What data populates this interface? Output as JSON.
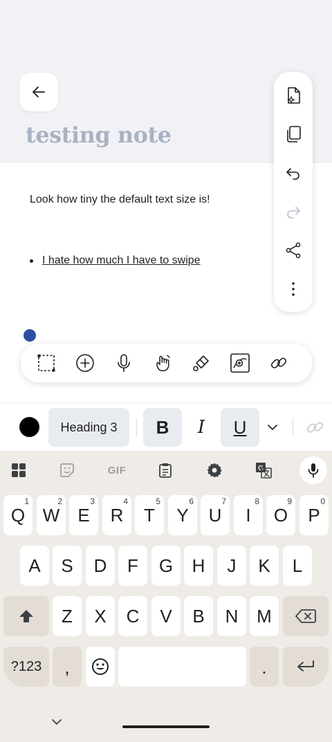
{
  "note": {
    "title": "testing note",
    "paragraph": "Look how tiny the default text size is!",
    "bullet": "I hate how much I have to swipe"
  },
  "side_toolbar": {
    "icons": [
      "ai-file-icon",
      "copy-icon",
      "undo-icon",
      "redo-icon",
      "share-icon",
      "more-vertical-icon"
    ]
  },
  "tool_bar": {
    "icons": [
      "selection-icon",
      "add-icon",
      "microphone-icon",
      "draw-icon",
      "eraser-icon",
      "image-insert-icon",
      "link-icon"
    ]
  },
  "format_bar": {
    "text_color": "#000000",
    "heading_label": "Heading 3",
    "bold_label": "B",
    "italic_label": "I",
    "underline_label": "U"
  },
  "keyboard": {
    "toolbar": {
      "gif_label": "GIF",
      "icons": [
        "apps-icon",
        "sticker-icon",
        "gif-icon",
        "clipboard-icon",
        "settings-icon",
        "translate-icon",
        "microphone-icon"
      ]
    },
    "row1": [
      {
        "k": "Q",
        "hint": "1"
      },
      {
        "k": "W",
        "hint": "2"
      },
      {
        "k": "E",
        "hint": "3"
      },
      {
        "k": "R",
        "hint": "4"
      },
      {
        "k": "T",
        "hint": "5"
      },
      {
        "k": "Y",
        "hint": "6"
      },
      {
        "k": "U",
        "hint": "7"
      },
      {
        "k": "I",
        "hint": "8"
      },
      {
        "k": "O",
        "hint": "9"
      },
      {
        "k": "P",
        "hint": "0"
      }
    ],
    "row2": [
      "A",
      "S",
      "D",
      "F",
      "G",
      "H",
      "J",
      "K",
      "L"
    ],
    "row3": [
      "Z",
      "X",
      "C",
      "V",
      "B",
      "N",
      "M"
    ],
    "bottom": {
      "symbols_label": "?123",
      "comma_label": ",",
      "period_label": "."
    }
  },
  "colors": {
    "accent": "#2d4fa0",
    "title": "#a9b2c2",
    "keyboard_bg": "#efebe7"
  }
}
